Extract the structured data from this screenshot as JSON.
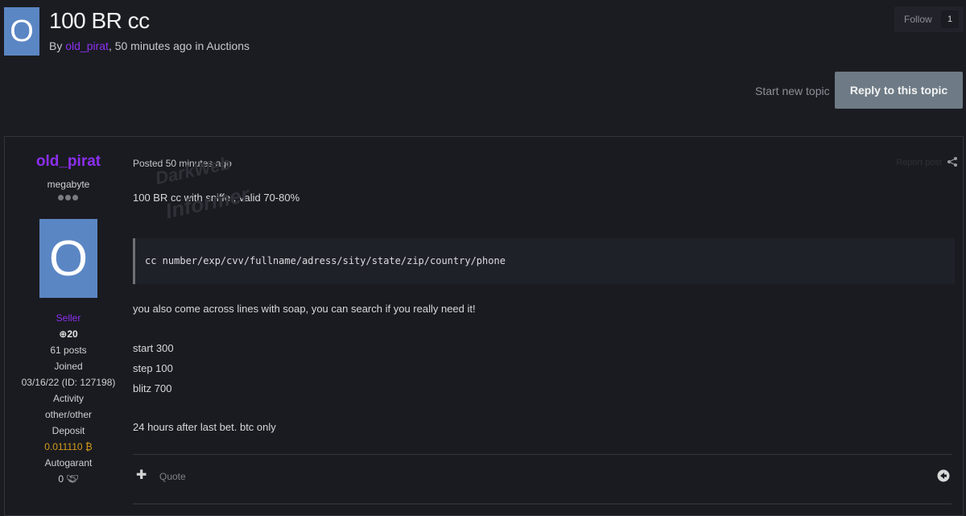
{
  "topic": {
    "avatar_letter": "O",
    "title": "100 BR cc",
    "by_prefix": "By ",
    "author": "old_pirat",
    "meta_suffix": ", 50 minutes ago in Auctions"
  },
  "follow": {
    "label": "Follow",
    "count": "1"
  },
  "actions": {
    "start_new_topic": "Start new topic",
    "reply": "Reply to this topic"
  },
  "post": {
    "author": {
      "name": "old_pirat",
      "rank": "megabyte",
      "avatar_letter": "O",
      "group": "Seller",
      "reputation": "20",
      "posts": "61 posts",
      "joined_label": "Joined",
      "joined_value": "03/16/22 (ID: 127198)",
      "activity_label": "Activity",
      "activity_value": "other/other",
      "deposit_label": "Deposit",
      "deposit_value": "0.011110 ₿",
      "autogarant_label": "Autogarant",
      "autogarant_value": "0"
    },
    "posted": "Posted 50 minutes ago",
    "report": "Report post",
    "body": {
      "line1": "100 BR cc with sniffer, valid 70-80%",
      "code": "cc number/exp/cvv/fullname/adress/sity/state/zip/country/phone",
      "line2": "you also come across lines with soap, you can search if you really need it!",
      "start": "start 300",
      "step": "step 100",
      "blitz": "blitz 700",
      "terms": "24 hours after last bet. btc only"
    },
    "footer": {
      "quote": "Quote"
    }
  },
  "watermark": {
    "line1": "DarkWeb",
    "line2": "Informer"
  },
  "colors": {
    "accent": "#8c2ff0",
    "avatar": "#5b86c4",
    "deposit": "#d59a1b",
    "reply_button": "#6e7b86"
  },
  "icons": [
    "share-icon",
    "plus-icon",
    "handshake-icon",
    "back-icon",
    "reputation-icon"
  ]
}
